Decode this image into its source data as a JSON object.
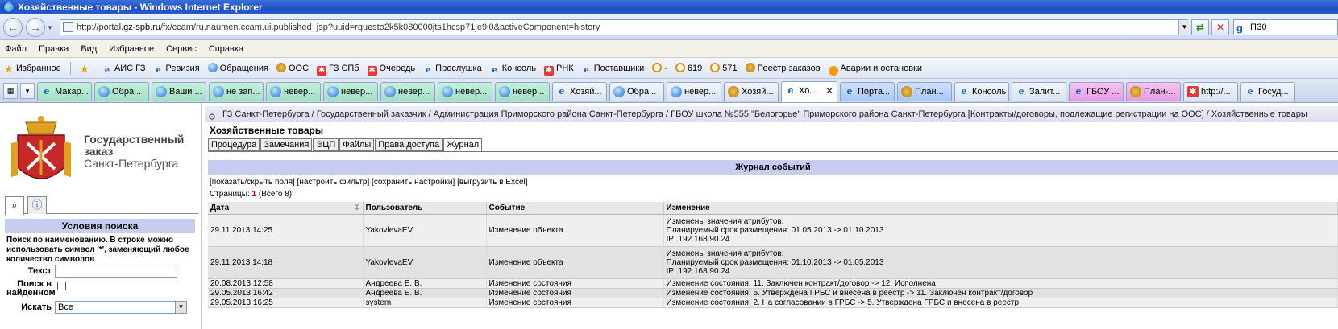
{
  "window": {
    "title": "Хозяйственные товары - Windows Internet Explorer"
  },
  "address": {
    "prefix": "http://portal.",
    "domain": "gz-spb.ru",
    "rest": "/fx/ccam/ru.naumen.ccam.ui.published_jsp?uuid=rquesto2k5k080000jts1hcsp71je9l0&activeComponent=history"
  },
  "search_engine": {
    "value": "ПЗ0"
  },
  "menu": [
    "Файл",
    "Правка",
    "Вид",
    "Избранное",
    "Сервис",
    "Справка"
  ],
  "favorites": {
    "label": "Избранное",
    "items": [
      {
        "label": "АИС ГЗ",
        "icon": "ie"
      },
      {
        "label": "Ревизия",
        "icon": "ie"
      },
      {
        "label": "Обращения",
        "icon": "globe"
      },
      {
        "label": "ООС",
        "icon": "seal"
      },
      {
        "label": "ГЗ СПб",
        "icon": "red"
      },
      {
        "label": "Очередь",
        "icon": "red"
      },
      {
        "label": "Прослушка",
        "icon": "ie"
      },
      {
        "label": "Консоль",
        "icon": "ie"
      },
      {
        "label": "РНК",
        "icon": "red"
      },
      {
        "label": "Поставщики",
        "icon": "ie"
      },
      {
        "label": "-",
        "icon": "clock"
      },
      {
        "label": "619",
        "icon": "clock"
      },
      {
        "label": "571",
        "icon": "clock"
      },
      {
        "label": "Реестр заказов",
        "icon": "seal"
      },
      {
        "label": "Аварии и остановки",
        "icon": "warn"
      }
    ]
  },
  "tabs": [
    {
      "label": "Макар...",
      "style": "green",
      "icon": "ie"
    },
    {
      "label": "Обра...",
      "style": "green",
      "icon": "globe"
    },
    {
      "label": "Ваши ...",
      "style": "green",
      "icon": "globe"
    },
    {
      "label": "не зап...",
      "style": "green",
      "icon": "globe"
    },
    {
      "label": "невер...",
      "style": "green",
      "icon": "globe"
    },
    {
      "label": "невер...",
      "style": "green",
      "icon": "globe"
    },
    {
      "label": "невер...",
      "style": "green",
      "icon": "globe"
    },
    {
      "label": "невер...",
      "style": "green",
      "icon": "globe"
    },
    {
      "label": "невер...",
      "style": "green",
      "icon": "globe"
    },
    {
      "label": "Хозяй...",
      "style": "plain",
      "icon": "ie"
    },
    {
      "label": "Обра...",
      "style": "plain",
      "icon": "globe"
    },
    {
      "label": "невер...",
      "style": "plain",
      "icon": "globe"
    },
    {
      "label": "Хозяй...",
      "style": "plain",
      "icon": "seal"
    },
    {
      "label": "Хо...",
      "style": "active",
      "icon": "ie"
    },
    {
      "label": "Порта...",
      "style": "blue",
      "icon": "ie"
    },
    {
      "label": "План...",
      "style": "blue",
      "icon": "seal"
    },
    {
      "label": "Консоль",
      "style": "plain",
      "icon": "ie"
    },
    {
      "label": "Залит...",
      "style": "plain",
      "icon": "ie"
    },
    {
      "label": "ГБОУ ...",
      "style": "pink",
      "icon": "ie"
    },
    {
      "label": "План-...",
      "style": "pink",
      "icon": "seal"
    },
    {
      "label": "http://...",
      "style": "plain",
      "icon": "red"
    },
    {
      "label": "Госуд...",
      "style": "plain",
      "icon": "ie"
    }
  ],
  "left": {
    "logo_line1": "Государственный",
    "logo_line2": "заказ",
    "logo_line3": "Санкт-Петербурга",
    "search_title": "Условия поиска",
    "search_hint": "Поиск по наименованию. В строке можно использовать символ '*', заменяющий любое количество символов",
    "text_label": "Текст",
    "text_value": "",
    "found_label_1": "Поиск в",
    "found_label_2": "найденном",
    "search_in_label": "Искать",
    "search_in_value": "Все"
  },
  "main": {
    "breadcrumb": "ГЗ Санкт-Петербурга / Государственный заказчик / Администрация Приморского района Санкт-Петербурга / ГБОУ школа №555 \"Белогорье\" Приморского района Санкт-Петербурга [Контракты/договоры, подлежащие регистрации на ООС] / Хозяйственные товары",
    "page_title": "Хозяйственные товары",
    "doc_tabs": [
      "Процедура",
      "Замечания",
      "ЭЦП",
      "Файлы",
      "Права доступа",
      "Журнал"
    ],
    "active_doc_tab": 5,
    "journal_title": "Журнал событий",
    "actions": "[показать/скрыть поля] [настроить фильтр] [сохранить настройки] [выгрузить в Excel]",
    "pages_label": "Страницы:",
    "pages_current": "1",
    "pages_total": "(Всего 8)",
    "columns": [
      "Дата",
      "Пользователь",
      "Событие",
      "Изменение"
    ],
    "rows": [
      {
        "date": "29.11.2013 14:25",
        "user": "YakovlevaEV",
        "event": "Изменение объекта",
        "change": [
          "Изменены значения атрибутов:",
          "Планируемый срок размещения: 01.05.2013 -> 01.10.2013",
          "IP: 192.168.90.24"
        ]
      },
      {
        "date": "29.11.2013 14:18",
        "user": "YakovlevaEV",
        "event": "Изменение объекта",
        "change": [
          "Изменены значения атрибутов:",
          "Планируемый срок размещения: 01.10.2013 -> 01.05.2013",
          "IP: 192.168.90.24"
        ]
      },
      {
        "date": "20.08.2013 12:58",
        "user": "Андреева Е. В.",
        "event": "Изменение состояния",
        "change": [
          "Изменение состояния: 11. Заключен контракт/договор -> 12. Исполнена"
        ]
      },
      {
        "date": "29.05.2013 16:42",
        "user": "Андреева Е. В.",
        "event": "Изменение состояния",
        "change": [
          "Изменение состояния: 5. Утверждена ГРБС и внесена в реестр -> 11. Заключен контракт/договор"
        ]
      },
      {
        "date": "29.05.2013 16:25",
        "user": "system",
        "event": "Изменение состояния",
        "change": [
          "Изменение состояния: 2. На согласовании в ГРБС -> 5. Утверждена ГРБС и внесена в реестр"
        ]
      }
    ]
  }
}
